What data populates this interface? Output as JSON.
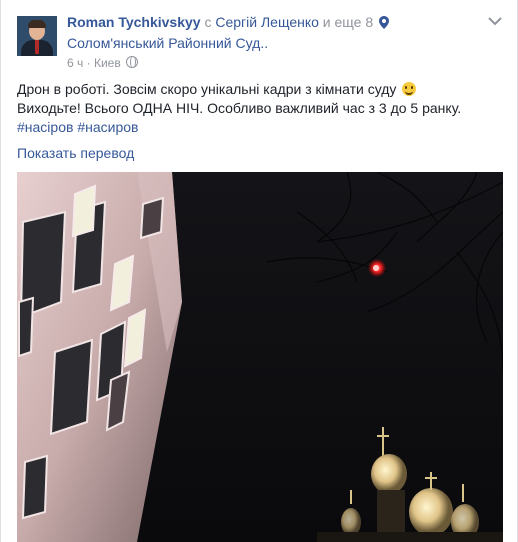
{
  "post": {
    "author": "Roman Tychkivskyy",
    "with_prefix": "с",
    "tagged_person": "Сергій Лещенко",
    "and_more": "и еще 8",
    "location": "Солом'янський Районний Суд..",
    "time": "6 ч",
    "separator": "·",
    "city": "Киев",
    "text_line1": "Дрон в роботі. Зовсім скоро унікальні кадри з кімнати суду",
    "text_line2": "Виходьте! Всього ОДНА НІЧ. Особливо важливий час з 3 до 5 ранку.",
    "hashtags": "#насіров #насиров",
    "translate_link": "Показать перевод"
  },
  "icons": {
    "location": "map-pin-icon",
    "privacy": "globe-icon",
    "menu": "chevron-down-icon",
    "emoji": "smiley-emoji"
  },
  "colors": {
    "link": "#365899",
    "text": "#1d2129",
    "meta": "#90949c",
    "background": "#e9ebee",
    "card": "#ffffff"
  }
}
